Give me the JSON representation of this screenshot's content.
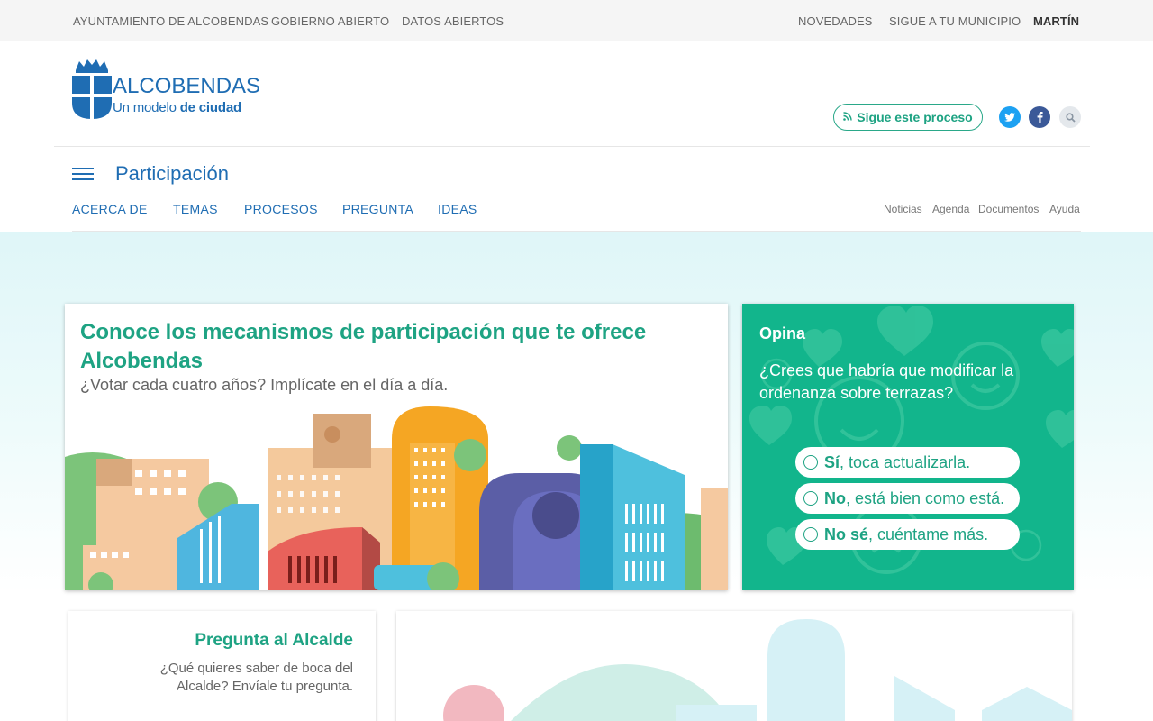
{
  "topbar": {
    "left_links": [
      "AYUNTAMIENTO DE ALCOBENDAS",
      "GOBIERNO ABIERTO",
      "DATOS ABIERTOS"
    ],
    "right_links": [
      "NOVEDADES",
      "SIGUE A TU MUNICIPIO"
    ],
    "user": "MARTÍN"
  },
  "header": {
    "logo_title": "ALCOBENDAS",
    "logo_sub_a": "Un modelo ",
    "logo_sub_b": "de ciudad",
    "follow_label": "Sigue este proceso",
    "icons": [
      "rss-icon",
      "twitter-icon",
      "facebook-icon",
      "search-icon"
    ]
  },
  "section": {
    "title": "Participación",
    "nav": [
      "ACERCA DE",
      "TEMAS",
      "PROCESOS",
      "PREGUNTA",
      "IDEAS"
    ],
    "subnav": [
      "Noticias",
      "Agenda",
      "Documentos",
      "Ayuda"
    ]
  },
  "hero": {
    "title": "Conoce los mecanismos de participación que te ofrece Alcobendas",
    "subtitle": "¿Votar cada cuatro años? Implícate en el día a día."
  },
  "poll": {
    "label": "Opina",
    "question": "¿Crees que habría que modificar la ordenanza sobre terrazas?",
    "options": [
      {
        "bold": "Sí",
        "rest": ", toca actualizarla."
      },
      {
        "bold": "No",
        "rest": ", está bien como está."
      },
      {
        "bold": "No sé",
        "rest": ", cuéntame más."
      }
    ]
  },
  "alcalde": {
    "title": "Pregunta al Alcalde",
    "text": "¿Qué quieres saber de boca del Alcalde? Envíale tu pregunta."
  },
  "colors": {
    "brand_blue": "#1f6db3",
    "brand_green": "#1ea383",
    "poll_bg": "#12b58c"
  }
}
